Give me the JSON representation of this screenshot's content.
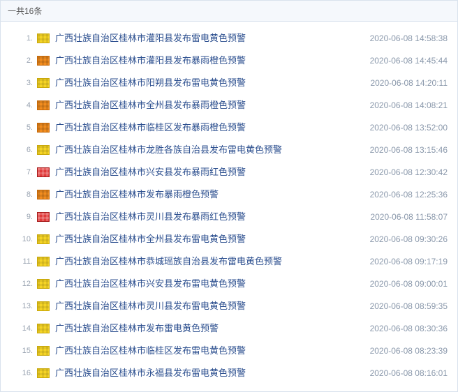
{
  "header": {
    "total_text": "一共16条"
  },
  "icon_colors": {
    "yellow": "#f5d425",
    "orange": "#f28c1e",
    "red": "#e03a3a"
  },
  "items": [
    {
      "title": "广西壮族自治区桂林市灌阳县发布雷电黄色预警",
      "time": "2020-06-08 14:58:38",
      "level": "yellow"
    },
    {
      "title": "广西壮族自治区桂林市灌阳县发布暴雨橙色预警",
      "time": "2020-06-08 14:45:44",
      "level": "orange"
    },
    {
      "title": "广西壮族自治区桂林市阳朔县发布雷电黄色预警",
      "time": "2020-06-08 14:20:11",
      "level": "yellow"
    },
    {
      "title": "广西壮族自治区桂林市全州县发布暴雨橙色预警",
      "time": "2020-06-08 14:08:21",
      "level": "orange"
    },
    {
      "title": "广西壮族自治区桂林市临桂区发布暴雨橙色预警",
      "time": "2020-06-08 13:52:00",
      "level": "orange"
    },
    {
      "title": "广西壮族自治区桂林市龙胜各族自治县发布雷电黄色预警",
      "time": "2020-06-08 13:15:46",
      "level": "yellow"
    },
    {
      "title": "广西壮族自治区桂林市兴安县发布暴雨红色预警",
      "time": "2020-06-08 12:30:42",
      "level": "red"
    },
    {
      "title": "广西壮族自治区桂林市发布暴雨橙色预警",
      "time": "2020-06-08 12:25:36",
      "level": "orange"
    },
    {
      "title": "广西壮族自治区桂林市灵川县发布暴雨红色预警",
      "time": "2020-06-08 11:58:07",
      "level": "red"
    },
    {
      "title": "广西壮族自治区桂林市全州县发布雷电黄色预警",
      "time": "2020-06-08 09:30:26",
      "level": "yellow"
    },
    {
      "title": "广西壮族自治区桂林市恭城瑶族自治县发布雷电黄色预警",
      "time": "2020-06-08 09:17:19",
      "level": "yellow"
    },
    {
      "title": "广西壮族自治区桂林市兴安县发布雷电黄色预警",
      "time": "2020-06-08 09:00:01",
      "level": "yellow"
    },
    {
      "title": "广西壮族自治区桂林市灵川县发布雷电黄色预警",
      "time": "2020-06-08 08:59:35",
      "level": "yellow"
    },
    {
      "title": "广西壮族自治区桂林市发布雷电黄色预警",
      "time": "2020-06-08 08:30:36",
      "level": "yellow"
    },
    {
      "title": "广西壮族自治区桂林市临桂区发布雷电黄色预警",
      "time": "2020-06-08 08:23:39",
      "level": "yellow"
    },
    {
      "title": "广西壮族自治区桂林市永福县发布雷电黄色预警",
      "time": "2020-06-08 08:16:01",
      "level": "yellow"
    }
  ]
}
